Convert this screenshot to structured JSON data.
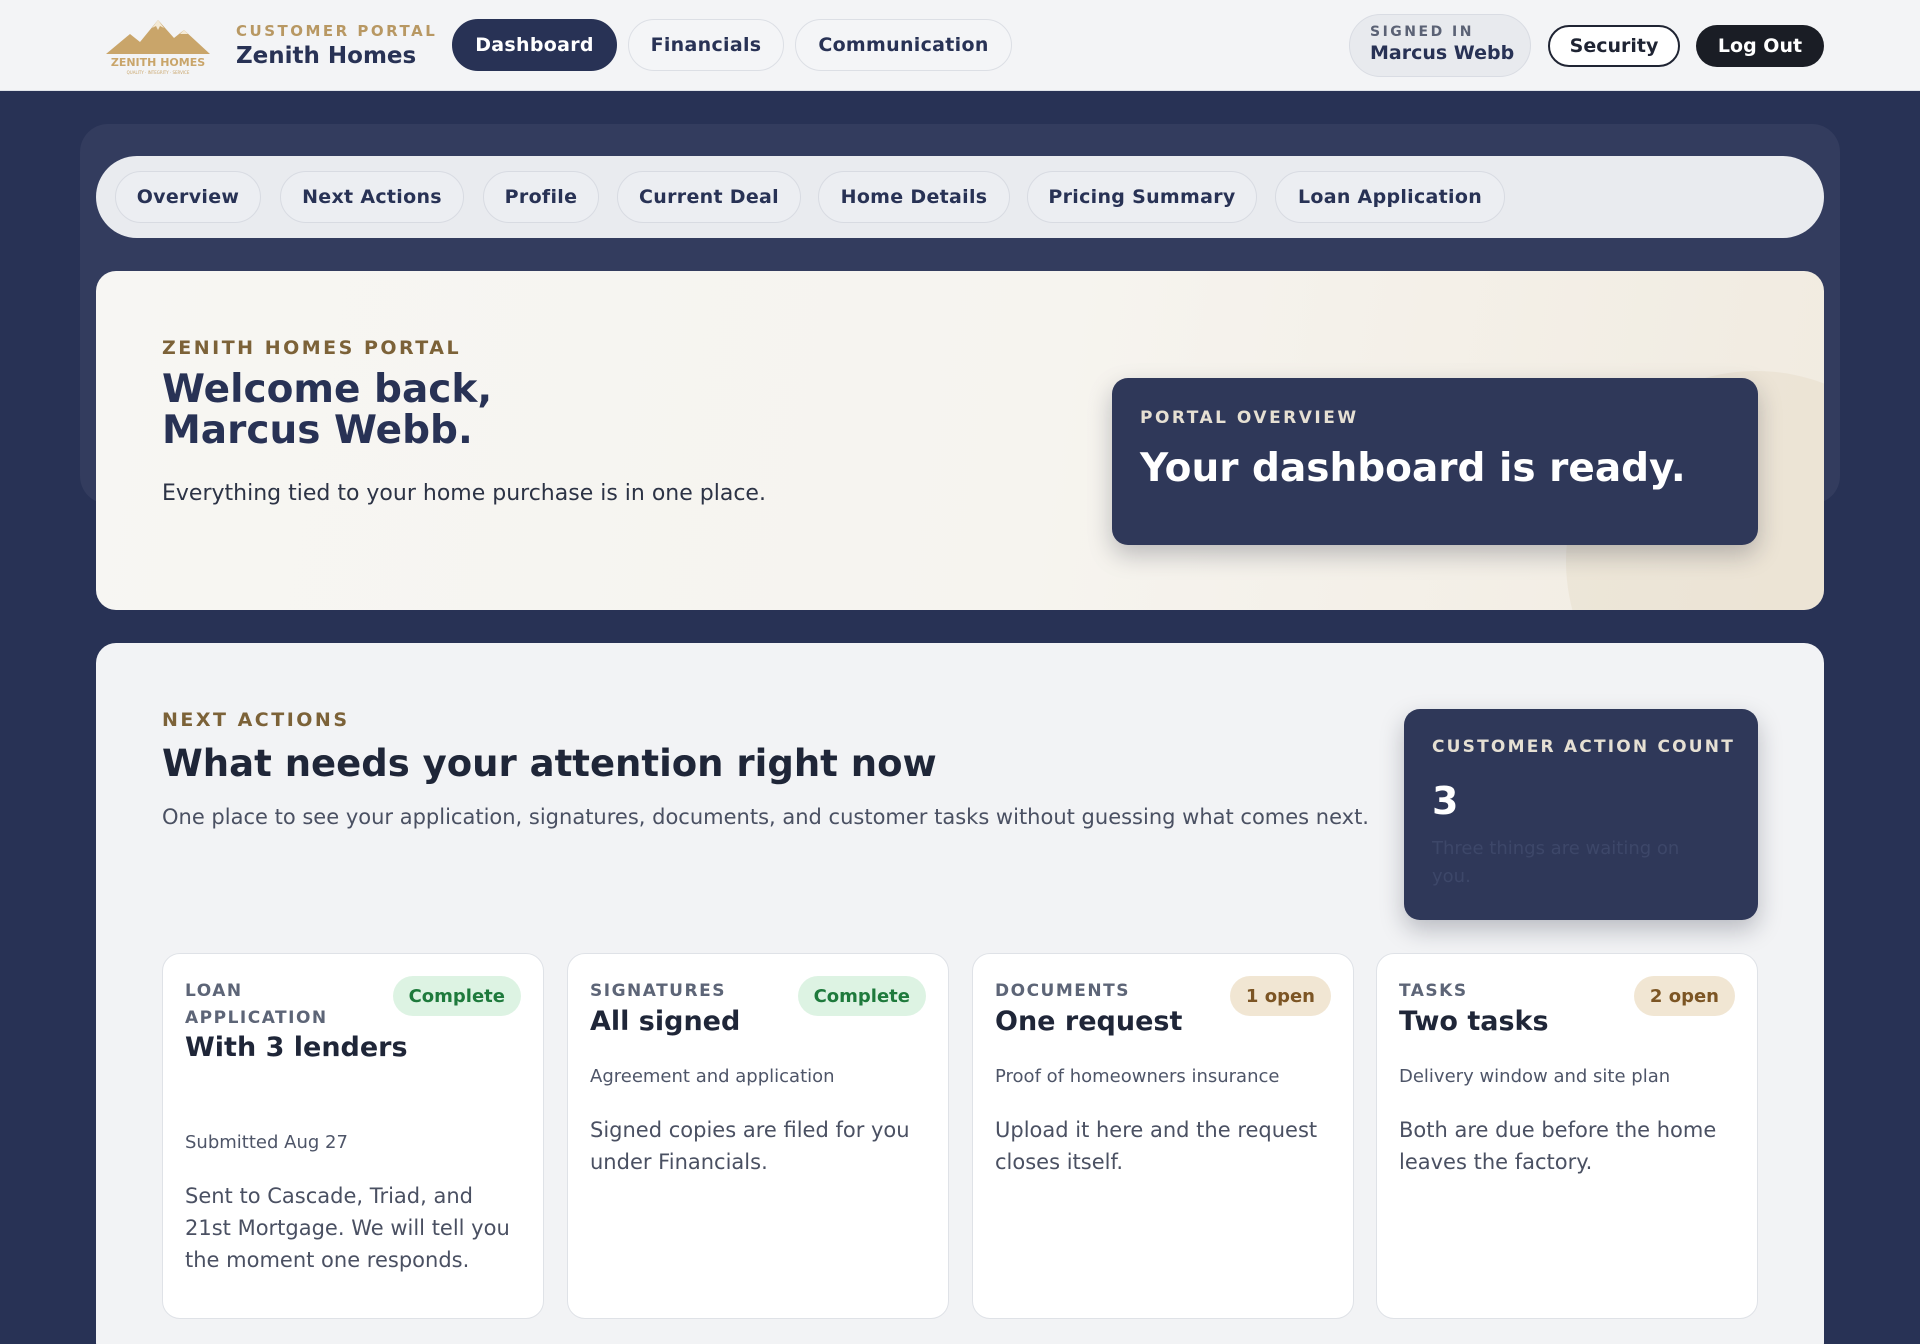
{
  "header": {
    "brand_eyebrow": "CUSTOMER PORTAL",
    "brand_name": "Zenith Homes",
    "logo_text": "ZENITH HOMES",
    "logo_tagline": "QUALITY · INTEGRITY · SERVICE",
    "nav": [
      {
        "label": "Dashboard",
        "active": true
      },
      {
        "label": "Financials",
        "active": false
      },
      {
        "label": "Communication",
        "active": false
      }
    ],
    "signed_in_label": "SIGNED IN",
    "signed_in_name": "Marcus Webb",
    "security_label": "Security",
    "logout_label": "Log Out"
  },
  "tabs": [
    "Overview",
    "Next Actions",
    "Profile",
    "Current Deal",
    "Home Details",
    "Pricing Summary",
    "Loan Application"
  ],
  "hero": {
    "eyebrow": "ZENITH HOMES PORTAL",
    "title": "Welcome back, Marcus Webb.",
    "subtitle": "Everything tied to your home purchase is in one place.",
    "overview_label": "PORTAL OVERVIEW",
    "overview_title": "Your dashboard is ready."
  },
  "actions": {
    "eyebrow": "NEXT ACTIONS",
    "title": "What needs your attention right now",
    "description": "One place to see your application, signatures, documents, and customer tasks without guessing what comes next.",
    "count_label": "CUSTOMER ACTION COUNT",
    "count_value": "3",
    "count_note": "Three things are waiting on you.",
    "cards": [
      {
        "label": "Loan Application",
        "badge": "Complete",
        "title": "With 3 lenders",
        "meta": "Submitted Aug 27",
        "body": "Sent to Cascade, Triad, and 21st Mortgage. We will tell you the moment one responds."
      },
      {
        "label": "Signatures",
        "badge": "Complete",
        "title": "All signed",
        "meta": "Agreement and application",
        "body": "Signed copies are filed for you under Financials."
      },
      {
        "label": "Documents",
        "badge": "1 open",
        "title": "One request",
        "meta": "Proof of homeowners insurance",
        "body": "Upload it here and the request closes itself."
      },
      {
        "label": "Tasks",
        "badge": "2 open",
        "title": "Two tasks",
        "meta": "Delivery window and site plan",
        "body": "Both are due before the home leaves the factory."
      }
    ]
  },
  "colors": {
    "navy": "#283255",
    "gold": "#b89863",
    "complete_bg": "#ddf3e3",
    "open_bg": "#f1e6d3"
  }
}
